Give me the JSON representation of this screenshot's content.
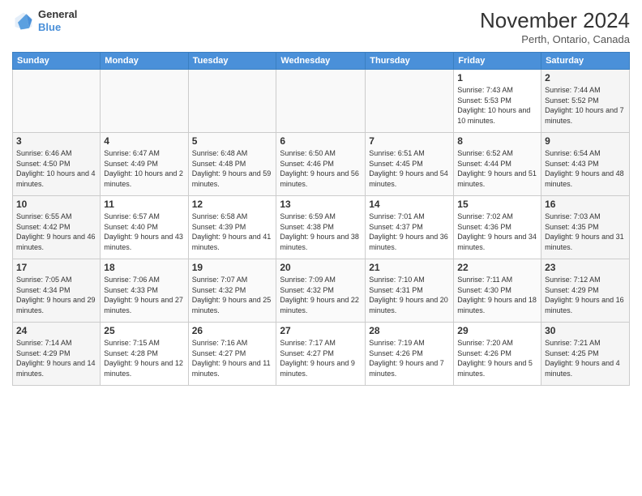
{
  "header": {
    "logo_line1": "General",
    "logo_line2": "Blue",
    "month_title": "November 2024",
    "location": "Perth, Ontario, Canada"
  },
  "days_of_week": [
    "Sunday",
    "Monday",
    "Tuesday",
    "Wednesday",
    "Thursday",
    "Friday",
    "Saturday"
  ],
  "weeks": [
    [
      {
        "day": "",
        "info": ""
      },
      {
        "day": "",
        "info": ""
      },
      {
        "day": "",
        "info": ""
      },
      {
        "day": "",
        "info": ""
      },
      {
        "day": "",
        "info": ""
      },
      {
        "day": "1",
        "info": "Sunrise: 7:43 AM\nSunset: 5:53 PM\nDaylight: 10 hours and 10 minutes."
      },
      {
        "day": "2",
        "info": "Sunrise: 7:44 AM\nSunset: 5:52 PM\nDaylight: 10 hours and 7 minutes."
      }
    ],
    [
      {
        "day": "3",
        "info": "Sunrise: 6:46 AM\nSunset: 4:50 PM\nDaylight: 10 hours and 4 minutes."
      },
      {
        "day": "4",
        "info": "Sunrise: 6:47 AM\nSunset: 4:49 PM\nDaylight: 10 hours and 2 minutes."
      },
      {
        "day": "5",
        "info": "Sunrise: 6:48 AM\nSunset: 4:48 PM\nDaylight: 9 hours and 59 minutes."
      },
      {
        "day": "6",
        "info": "Sunrise: 6:50 AM\nSunset: 4:46 PM\nDaylight: 9 hours and 56 minutes."
      },
      {
        "day": "7",
        "info": "Sunrise: 6:51 AM\nSunset: 4:45 PM\nDaylight: 9 hours and 54 minutes."
      },
      {
        "day": "8",
        "info": "Sunrise: 6:52 AM\nSunset: 4:44 PM\nDaylight: 9 hours and 51 minutes."
      },
      {
        "day": "9",
        "info": "Sunrise: 6:54 AM\nSunset: 4:43 PM\nDaylight: 9 hours and 48 minutes."
      }
    ],
    [
      {
        "day": "10",
        "info": "Sunrise: 6:55 AM\nSunset: 4:42 PM\nDaylight: 9 hours and 46 minutes."
      },
      {
        "day": "11",
        "info": "Sunrise: 6:57 AM\nSunset: 4:40 PM\nDaylight: 9 hours and 43 minutes."
      },
      {
        "day": "12",
        "info": "Sunrise: 6:58 AM\nSunset: 4:39 PM\nDaylight: 9 hours and 41 minutes."
      },
      {
        "day": "13",
        "info": "Sunrise: 6:59 AM\nSunset: 4:38 PM\nDaylight: 9 hours and 38 minutes."
      },
      {
        "day": "14",
        "info": "Sunrise: 7:01 AM\nSunset: 4:37 PM\nDaylight: 9 hours and 36 minutes."
      },
      {
        "day": "15",
        "info": "Sunrise: 7:02 AM\nSunset: 4:36 PM\nDaylight: 9 hours and 34 minutes."
      },
      {
        "day": "16",
        "info": "Sunrise: 7:03 AM\nSunset: 4:35 PM\nDaylight: 9 hours and 31 minutes."
      }
    ],
    [
      {
        "day": "17",
        "info": "Sunrise: 7:05 AM\nSunset: 4:34 PM\nDaylight: 9 hours and 29 minutes."
      },
      {
        "day": "18",
        "info": "Sunrise: 7:06 AM\nSunset: 4:33 PM\nDaylight: 9 hours and 27 minutes."
      },
      {
        "day": "19",
        "info": "Sunrise: 7:07 AM\nSunset: 4:32 PM\nDaylight: 9 hours and 25 minutes."
      },
      {
        "day": "20",
        "info": "Sunrise: 7:09 AM\nSunset: 4:32 PM\nDaylight: 9 hours and 22 minutes."
      },
      {
        "day": "21",
        "info": "Sunrise: 7:10 AM\nSunset: 4:31 PM\nDaylight: 9 hours and 20 minutes."
      },
      {
        "day": "22",
        "info": "Sunrise: 7:11 AM\nSunset: 4:30 PM\nDaylight: 9 hours and 18 minutes."
      },
      {
        "day": "23",
        "info": "Sunrise: 7:12 AM\nSunset: 4:29 PM\nDaylight: 9 hours and 16 minutes."
      }
    ],
    [
      {
        "day": "24",
        "info": "Sunrise: 7:14 AM\nSunset: 4:29 PM\nDaylight: 9 hours and 14 minutes."
      },
      {
        "day": "25",
        "info": "Sunrise: 7:15 AM\nSunset: 4:28 PM\nDaylight: 9 hours and 12 minutes."
      },
      {
        "day": "26",
        "info": "Sunrise: 7:16 AM\nSunset: 4:27 PM\nDaylight: 9 hours and 11 minutes."
      },
      {
        "day": "27",
        "info": "Sunrise: 7:17 AM\nSunset: 4:27 PM\nDaylight: 9 hours and 9 minutes."
      },
      {
        "day": "28",
        "info": "Sunrise: 7:19 AM\nSunset: 4:26 PM\nDaylight: 9 hours and 7 minutes."
      },
      {
        "day": "29",
        "info": "Sunrise: 7:20 AM\nSunset: 4:26 PM\nDaylight: 9 hours and 5 minutes."
      },
      {
        "day": "30",
        "info": "Sunrise: 7:21 AM\nSunset: 4:25 PM\nDaylight: 9 hours and 4 minutes."
      }
    ]
  ]
}
